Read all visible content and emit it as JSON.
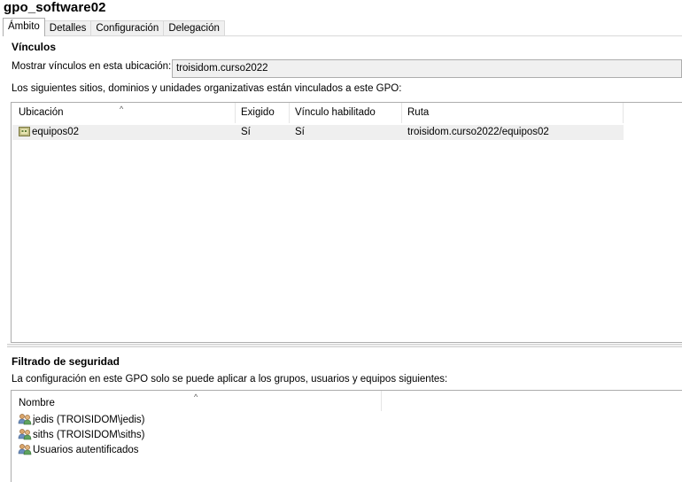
{
  "window": {
    "title": "gpo_software02"
  },
  "tabs": [
    {
      "label": "Ámbito",
      "active": true
    },
    {
      "label": "Detalles",
      "active": false
    },
    {
      "label": "Configuración",
      "active": false
    },
    {
      "label": "Delegación",
      "active": false
    }
  ],
  "links": {
    "heading": "Vínculos",
    "location_label": "Mostrar vínculos en esta ubicación:",
    "location_value": "troisidom.curso2022",
    "description": "Los siguientes sitios, dominios y unidades organizativas están vinculados a este GPO:",
    "columns": [
      "Ubicación",
      "Exigido",
      "Vínculo habilitado",
      "Ruta"
    ],
    "rows": [
      {
        "location": "equipos02",
        "enforced": "Sí",
        "link_enabled": "Sí",
        "path": "troisidom.curso2022/equipos02",
        "icon": "ou-folder-icon"
      }
    ]
  },
  "security": {
    "heading": "Filtrado de seguridad",
    "description": "La configuración en este GPO solo se puede aplicar a los grupos, usuarios y equipos siguientes:",
    "column": "Nombre",
    "items": [
      {
        "name": "jedis (TROISIDOM\\jedis)",
        "icon": "group-icon"
      },
      {
        "name": "siths (TROISIDOM\\siths)",
        "icon": "group-icon"
      },
      {
        "name": "Usuarios autentificados",
        "icon": "group-icon"
      }
    ]
  },
  "colors": {
    "header_line": "#e5e5e5",
    "selected_row": "#efefef",
    "border": "#adadad"
  }
}
